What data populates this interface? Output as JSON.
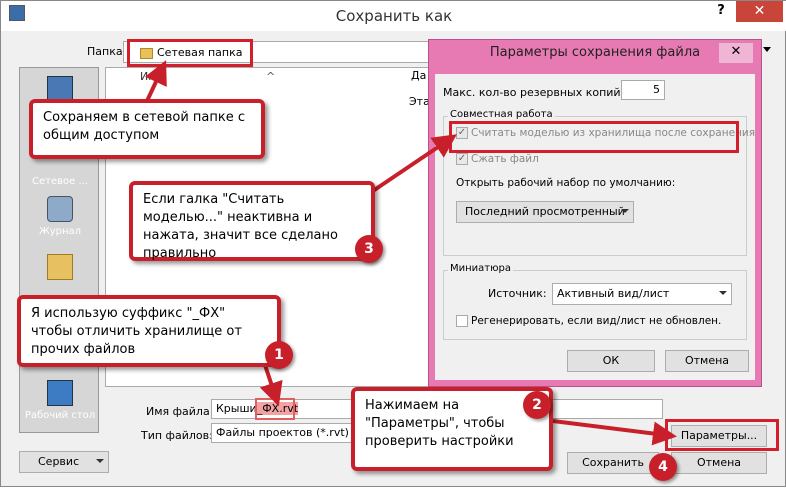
{
  "window": {
    "title": "Сохранить как",
    "help": "?",
    "close": "✕"
  },
  "folder": {
    "label": "Папка:",
    "value": "Сетевая папка"
  },
  "places": [
    {
      "label": "Сетевое ..."
    },
    {
      "label": "Журнал"
    },
    {
      "label": "Рабочий стол"
    }
  ],
  "filelist": {
    "col_name": "Имя",
    "col_date": "Да",
    "row_partial": "Эта"
  },
  "filename": {
    "label": "Имя файла:",
    "value_prefix": "Крыши",
    "value_suffix": "_ФХ.rvt"
  },
  "filetype": {
    "label": "Тип файлов:",
    "value": "Файлы проектов  (*.rvt)"
  },
  "buttons": {
    "service": "Сервис",
    "options": "Параметры...",
    "save": "Сохранить",
    "cancel": "Отмена"
  },
  "dialog": {
    "title": "Параметры сохранения файла",
    "close": "✕",
    "max_backups_label": "Макс. кол-во резервных копий:",
    "max_backups_value": "5",
    "worksharing_title": "Совместная работа",
    "chk_make_central": "Считать моделью из хранилища после сохранения",
    "chk_compact": "Сжать файл",
    "open_workset_label": "Открыть рабочий набор по умолчанию:",
    "open_workset_value": "Последний просмотренный",
    "thumbnail_title": "Миниатюра",
    "source_label": "Источник:",
    "source_value": "Активный вид/лист",
    "chk_regenerate": "Регенерировать, если вид/лист не обновлен.",
    "ok": "ОК",
    "cancel": "Отмена"
  },
  "callouts": {
    "c_network": "Сохраняем в сетевой папке с общим доступом",
    "c_checkbox": "Если галка \"Считать моделью...\" неактивна и нажата, значит все сделано правильно",
    "c_suffix": "Я использую суффикс \"_ФХ\" чтобы отличить хранилище от прочих файлов",
    "c_params": "Нажимаем на \"Параметры\", чтобы проверить настройки"
  },
  "badges": [
    "1",
    "2",
    "3",
    "4"
  ],
  "colors": {
    "annotation_red": "#c8202a",
    "dialog_frame": "#e77ab3"
  }
}
